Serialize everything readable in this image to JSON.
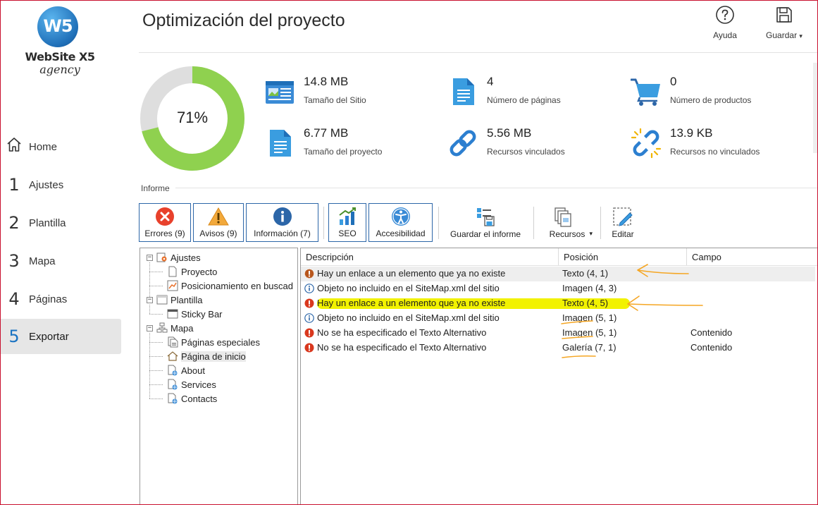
{
  "app": {
    "name": "WebSite X5",
    "edition": "agency"
  },
  "sidebar": {
    "items": [
      {
        "num": "",
        "label": "Home",
        "icon": "home-icon"
      },
      {
        "num": "1",
        "label": "Ajustes"
      },
      {
        "num": "2",
        "label": "Plantilla"
      },
      {
        "num": "3",
        "label": "Mapa"
      },
      {
        "num": "4",
        "label": "Páginas"
      },
      {
        "num": "5",
        "label": "Exportar",
        "active": true
      }
    ]
  },
  "header": {
    "title": "Optimización del proyecto",
    "help_label": "Ayuda",
    "save_label": "Guardar",
    "save_arrow": "▾"
  },
  "summary": {
    "score": "71%",
    "score_fraction": 0.71,
    "stats": [
      {
        "value": "14.8 MB",
        "caption": "Tamaño del Sitio",
        "icon": "site-size-icon"
      },
      {
        "value": "4",
        "caption": "Número de páginas",
        "icon": "pages-icon"
      },
      {
        "value": "0",
        "caption": "Número de productos",
        "icon": "cart-icon"
      },
      {
        "value": "6.77 MB",
        "caption": "Tamaño del proyecto",
        "icon": "project-file-icon"
      },
      {
        "value": "5.56 MB",
        "caption": "Recursos vinculados",
        "icon": "link-icon"
      },
      {
        "value": "13.9 KB",
        "caption": "Recursos no vinculados",
        "icon": "broken-link-icon"
      }
    ]
  },
  "report": {
    "section_label": "Informe",
    "toolbar": {
      "errors": "Errores (9)",
      "warnings": "Avisos (9)",
      "info": "Información (7)",
      "seo": "SEO",
      "accessibility": "Accesibilidad",
      "save_report": "Guardar el informe",
      "resources": "Recursos",
      "resources_arrow": "▾",
      "edit": "Editar"
    },
    "tree": [
      {
        "label": "Ajustes",
        "level": 0
      },
      {
        "label": "Proyecto",
        "level": 1
      },
      {
        "label": "Posicionamiento en buscad",
        "level": 1
      },
      {
        "label": "Plantilla",
        "level": 0
      },
      {
        "label": "Sticky Bar",
        "level": 1
      },
      {
        "label": "Mapa",
        "level": 0
      },
      {
        "label": "Páginas especiales",
        "level": 1
      },
      {
        "label": "Página de inicio",
        "level": 1,
        "selected": true
      },
      {
        "label": "About",
        "level": 1
      },
      {
        "label": "Services",
        "level": 1
      },
      {
        "label": "Contacts",
        "level": 1
      }
    ],
    "columns": {
      "description": "Descripción",
      "position": "Posición",
      "field": "Campo"
    },
    "rows": [
      {
        "type": "error-pending",
        "description": "Hay un enlace a un elemento que ya no existe",
        "position": "Texto (4, 1)",
        "field": ""
      },
      {
        "type": "info",
        "description": "Objeto no incluido en el SiteMap.xml del sitio",
        "position": "Imagen (4, 3)",
        "field": ""
      },
      {
        "type": "error",
        "description": "Hay un enlace a un elemento que ya no existe",
        "position": "Texto (4, 5)",
        "field": ""
      },
      {
        "type": "info",
        "description": "Objeto no incluido en el SiteMap.xml del sitio",
        "position": "Imagen (5, 1)",
        "field": ""
      },
      {
        "type": "error",
        "description": "No se ha especificado el Texto Alternativo",
        "position": "Imagen (5, 1)",
        "field": "Contenido"
      },
      {
        "type": "error",
        "description": "No se ha especificado el Texto Alternativo",
        "position": "Galería (7, 1)",
        "field": "Contenido"
      }
    ]
  },
  "colors": {
    "accent": "#1a73c2",
    "donut_fill": "#8fd14f",
    "donut_track": "#dedede",
    "error": "#e8412c",
    "warning": "#f0a020",
    "info": "#2c66a8",
    "highlighter": "#f2f200",
    "annotation": "#f5a623"
  }
}
